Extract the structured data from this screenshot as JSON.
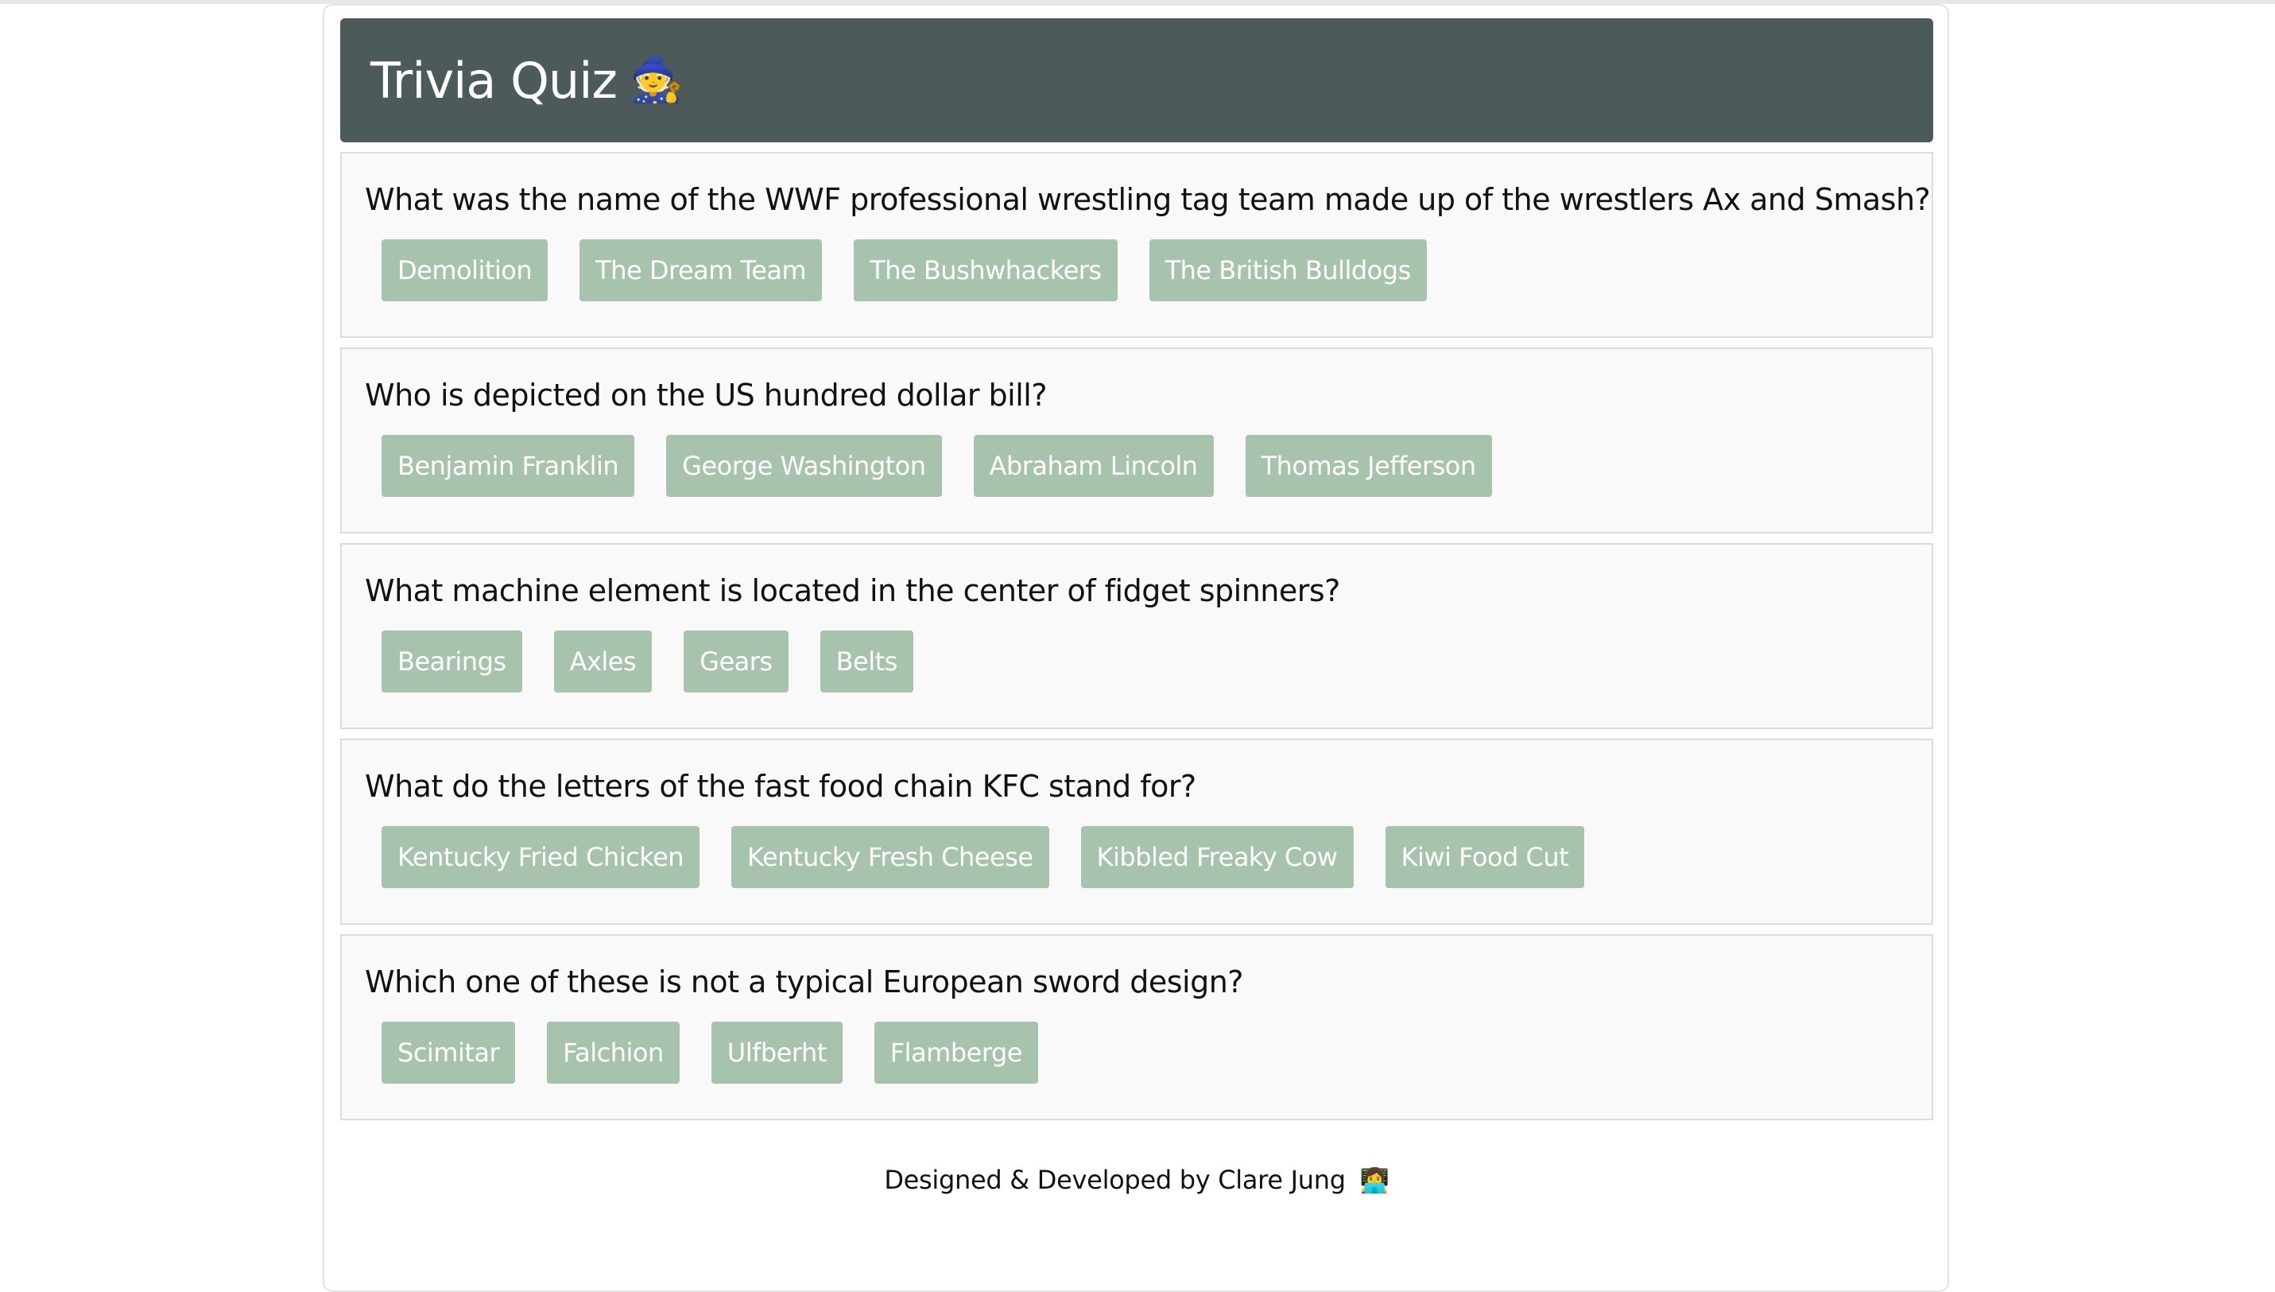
{
  "header": {
    "title": "Trivia Quiz",
    "emoji": "🧙"
  },
  "questions": [
    {
      "text": "What was the name of the WWF professional wrestling tag team made up of the wrestlers Ax and Smash?",
      "answers": [
        "Demolition",
        "The Dream Team",
        "The Bushwhackers",
        "The British Bulldogs"
      ]
    },
    {
      "text": "Who is depicted on the US hundred dollar bill?",
      "answers": [
        "Benjamin Franklin",
        "George Washington",
        "Abraham Lincoln",
        "Thomas Jefferson"
      ]
    },
    {
      "text": "What machine element is located in the center of fidget spinners?",
      "answers": [
        "Bearings",
        "Axles",
        "Gears",
        "Belts"
      ]
    },
    {
      "text": "What do the letters of the fast food chain KFC stand for?",
      "answers": [
        "Kentucky Fried Chicken",
        "Kentucky Fresh Cheese",
        "Kibbled Freaky Cow",
        "Kiwi Food Cut"
      ]
    },
    {
      "text": "Which one of these is not a typical European sword design?",
      "answers": [
        "Scimitar",
        "Falchion",
        "Ulfberht",
        "Flamberge"
      ]
    }
  ],
  "footer": {
    "text": "Designed & Developed by Clare Jung",
    "emoji": "👩‍💻"
  },
  "colors": {
    "header_bg": "#4c5a5a",
    "answer_bg": "#a8c3ad",
    "question_box_bg": "#f9f9f9"
  }
}
